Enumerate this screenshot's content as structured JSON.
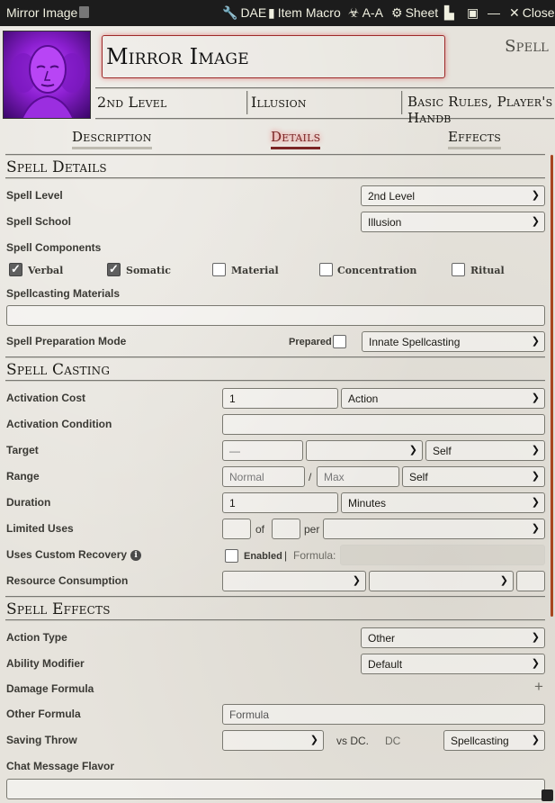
{
  "window": {
    "title": "Mirror Image",
    "controls": [
      {
        "icon": "wrench-icon",
        "glyph": "🔧",
        "label": "DAE"
      },
      {
        "icon": "document-icon",
        "glyph": "▮",
        "label": "Item Macro"
      },
      {
        "icon": "biohazard-icon",
        "glyph": "☣",
        "label": "A-A"
      },
      {
        "icon": "gear-icon",
        "glyph": "⚙",
        "label": "Sheet"
      },
      {
        "icon": "bookmark-icon",
        "glyph": "▙",
        "label": ""
      },
      {
        "icon": "journal-icon",
        "glyph": "▣",
        "label": ""
      },
      {
        "icon": "minimize-icon",
        "glyph": "—",
        "label": ""
      },
      {
        "icon": "close-icon",
        "glyph": "✕",
        "label": "Close"
      }
    ]
  },
  "header": {
    "item_name": "Mirror Image",
    "item_type": "Spell",
    "level": "2nd Level",
    "school": "Illusion",
    "source": "Basic Rules, Player's Handb"
  },
  "tabs": [
    {
      "label": "Description",
      "active": false
    },
    {
      "label": "Details",
      "active": true
    },
    {
      "label": "Effects",
      "active": false
    }
  ],
  "spell_details": {
    "heading": "Spell Details",
    "level_label": "Spell Level",
    "level_value": "2nd Level",
    "school_label": "Spell School",
    "school_value": "Illusion",
    "components_label": "Spell Components",
    "components": [
      {
        "label": "Verbal",
        "checked": true
      },
      {
        "label": "Somatic",
        "checked": true
      },
      {
        "label": "Material",
        "checked": false
      },
      {
        "label": "Concentration",
        "checked": false
      },
      {
        "label": "Ritual",
        "checked": false
      }
    ],
    "materials_label": "Spellcasting Materials",
    "materials_value": "",
    "prep_label": "Spell Preparation Mode",
    "prepared_label": "Prepared",
    "prepared_checked": false,
    "prep_mode": "Innate Spellcasting"
  },
  "spell_casting": {
    "heading": "Spell Casting",
    "activation_cost_label": "Activation Cost",
    "activation_cost_value": "1",
    "activation_type": "Action",
    "activation_condition_label": "Activation Condition",
    "activation_condition_value": "",
    "target_label": "Target",
    "target_value": "—",
    "target_units": "",
    "target_type": "Self",
    "range_label": "Range",
    "range_normal_placeholder": "Normal",
    "range_sep": "/",
    "range_max_placeholder": "Max",
    "range_units": "Self",
    "duration_label": "Duration",
    "duration_value": "1",
    "duration_units": "Minutes",
    "uses_label": "Limited Uses",
    "uses_of": "of",
    "uses_per": "per",
    "recovery_label": "Uses Custom Recovery",
    "recovery_enabled_label": "Enabled",
    "recovery_sep": "|",
    "recovery_formula_label": "Formula:",
    "consumption_label": "Resource Consumption"
  },
  "spell_effects": {
    "heading": "Spell Effects",
    "action_type_label": "Action Type",
    "action_type_value": "Other",
    "ability_label": "Ability Modifier",
    "ability_value": "Default",
    "damage_label": "Damage Formula",
    "damage_add": "+",
    "other_formula_label": "Other Formula",
    "other_formula_placeholder": "Formula",
    "saving_throw_label": "Saving Throw",
    "saving_vs": "vs DC.",
    "saving_dc_placeholder": "DC",
    "saving_scaling": "Spellcasting",
    "chat_flavor_label": "Chat Message Flavor"
  }
}
